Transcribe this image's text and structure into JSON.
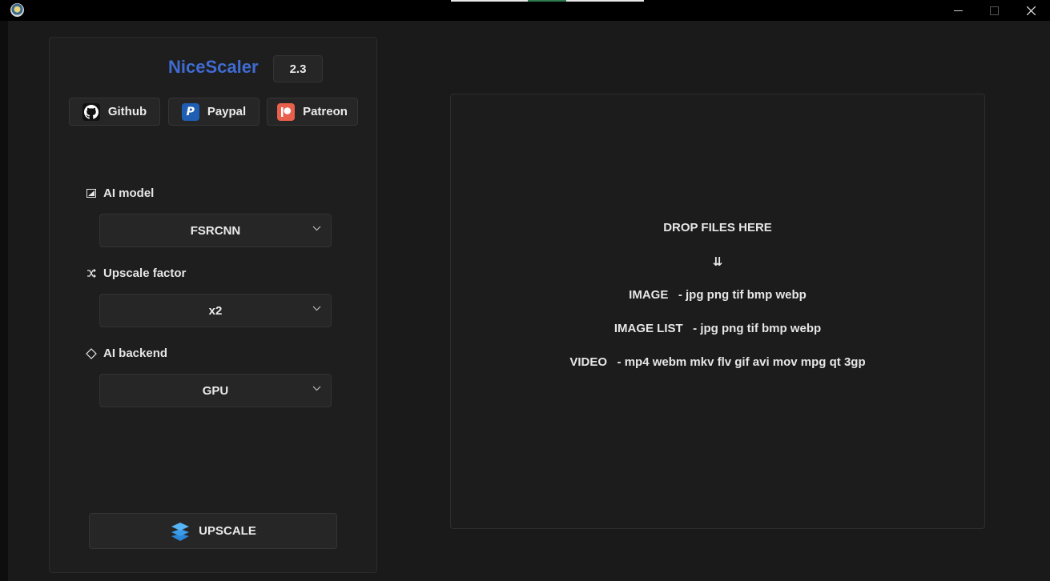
{
  "window": {
    "minimize_icon": "minimize-icon",
    "maximize_icon": "maximize-icon",
    "close_icon": "close-icon"
  },
  "sidebar": {
    "app_name": "NiceScaler",
    "version": "2.3",
    "links": [
      {
        "label": "Github",
        "icon": "github-icon"
      },
      {
        "label": "Paypal",
        "icon": "paypal-icon"
      },
      {
        "label": "Patreon",
        "icon": "patreon-icon"
      }
    ],
    "ai_model": {
      "label": "AI model",
      "value": "FSRCNN"
    },
    "upscale_factor": {
      "label": "Upscale factor",
      "value": "x2"
    },
    "ai_backend": {
      "label": "AI backend",
      "value": "GPU"
    },
    "upscale_button": "UPSCALE"
  },
  "dropzone": {
    "title": "DROP FILES HERE",
    "arrow": "⇊",
    "lines": [
      "IMAGE   - jpg png tif bmp webp",
      "IMAGE LIST   - jpg png tif bmp webp",
      "VIDEO   - mp4 webm mkv flv gif avi mov mpg qt 3gp"
    ]
  },
  "colors": {
    "brand": "#3f6bd2",
    "background": "#1a1a1a",
    "panel": "#1e1e1e",
    "paypal": "#1f5fb3",
    "patreon": "#e8604c"
  }
}
